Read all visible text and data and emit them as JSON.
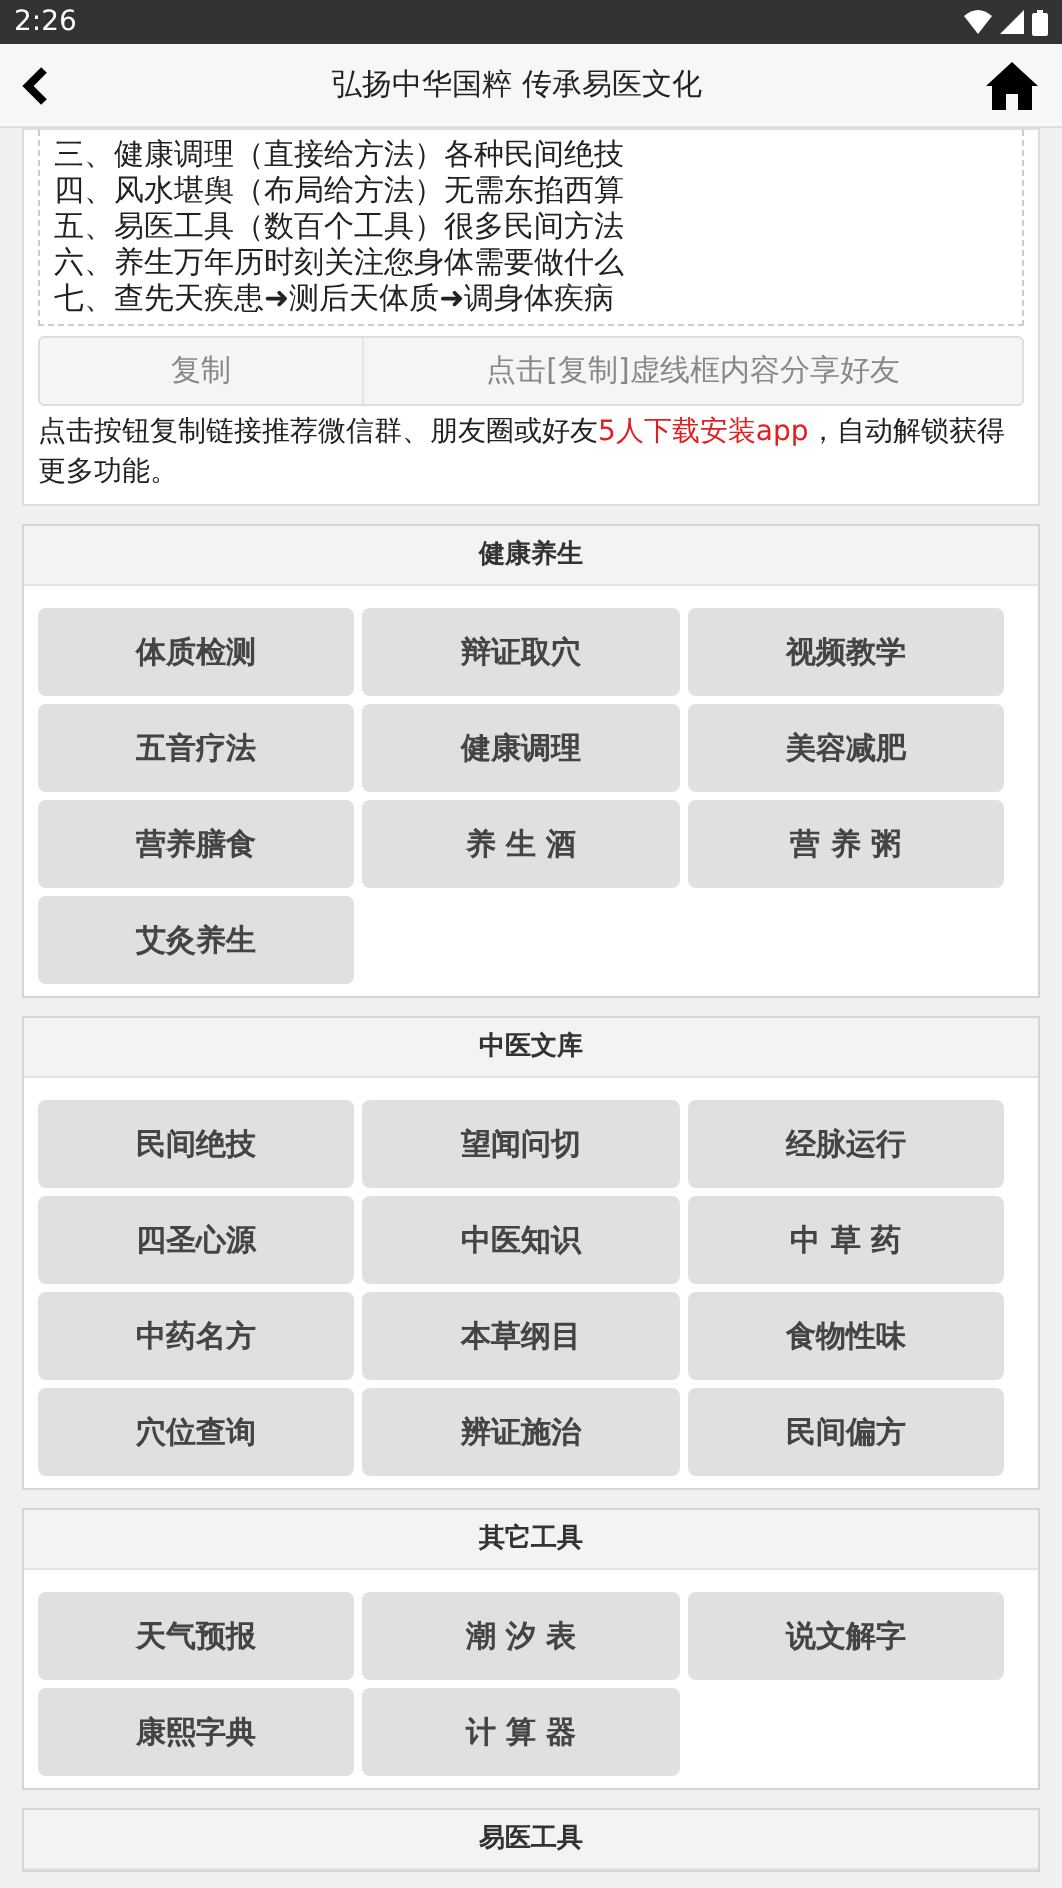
{
  "status_bar": {
    "time": "2:26"
  },
  "header": {
    "title": "弘扬中华国粹 传承易医文化"
  },
  "intro": {
    "lines": [
      "三、健康调理（直接给方法）各种民间绝技",
      "四、风水堪舆（布局给方法）无需东掐西算",
      "五、易医工具（数百个工具）很多民间方法",
      "六、养生万年历时刻关注您身体需要做什么",
      "七、查先天疾患➜测后天体质➜调身体疾病"
    ],
    "copy_button": "复制",
    "share_hint": "点击[复制]虚线框内容分享好友",
    "note": [
      {
        "text": "点击按钮复制链接推荐微信群、朋友圈或好友",
        "highlight": false
      },
      {
        "text": "5人下载安装app",
        "highlight": true
      },
      {
        "text": "，自动解锁获得更多功能。",
        "highlight": false
      }
    ]
  },
  "sections": [
    {
      "title": "健康养生",
      "items": [
        "体质检测",
        "辩证取穴",
        "视频教学",
        "五音疗法",
        "健康调理",
        "美容减肥",
        "营养膳食",
        "养 生 酒",
        "营 养 粥",
        "艾灸养生"
      ]
    },
    {
      "title": "中医文库",
      "items": [
        "民间绝技",
        "望闻问切",
        "经脉运行",
        "四圣心源",
        "中医知识",
        "中 草 药",
        "中药名方",
        "本草纲目",
        "食物性味",
        "穴位查询",
        "辨证施治",
        "民间偏方"
      ]
    },
    {
      "title": "其它工具",
      "items": [
        "天气预报",
        "潮 汐 表",
        "说文解字",
        "康熙字典",
        "计 算 器"
      ]
    },
    {
      "title": "易医工具"
    }
  ]
}
